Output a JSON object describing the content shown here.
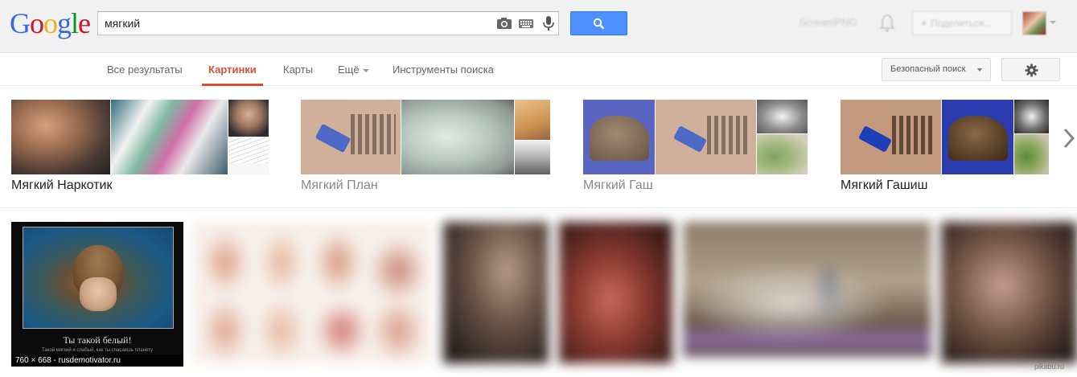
{
  "brand": {
    "logo_letters": [
      "G",
      "o",
      "o",
      "g",
      "l",
      "e"
    ]
  },
  "search": {
    "query": "мягкий",
    "button_icon": "search-icon"
  },
  "header": {
    "user_name": "ScreamPNG",
    "share_label": "Поделиться..."
  },
  "nav": {
    "tabs": [
      {
        "label": "Все результаты",
        "active": false
      },
      {
        "label": "Картинки",
        "active": true
      },
      {
        "label": "Карты",
        "active": false
      },
      {
        "label": "Ещё",
        "active": false
      },
      {
        "label": "Инструменты поиска",
        "active": false
      }
    ],
    "safe_search_label": "Безопасный поиск",
    "settings_icon": "gear-icon"
  },
  "related_searches": [
    {
      "label": "Мягкий Наркотик"
    },
    {
      "label": "Мягкий План"
    },
    {
      "label": "Мягкий Гаш"
    },
    {
      "label": "Мягкий Гашиш"
    }
  ],
  "results": {
    "first": {
      "title": "Ты такой белый!",
      "subtitle": "Такой мягкий и слабый, как ты спасаешь планету",
      "size_label": "760 × 668 - rusdemotivator.ru"
    }
  },
  "watermark": "pikabu.ru",
  "colors": {
    "accent_red": "#dd4b39",
    "search_blue": "#4d90fe",
    "header_bg": "#f1f1f1"
  }
}
